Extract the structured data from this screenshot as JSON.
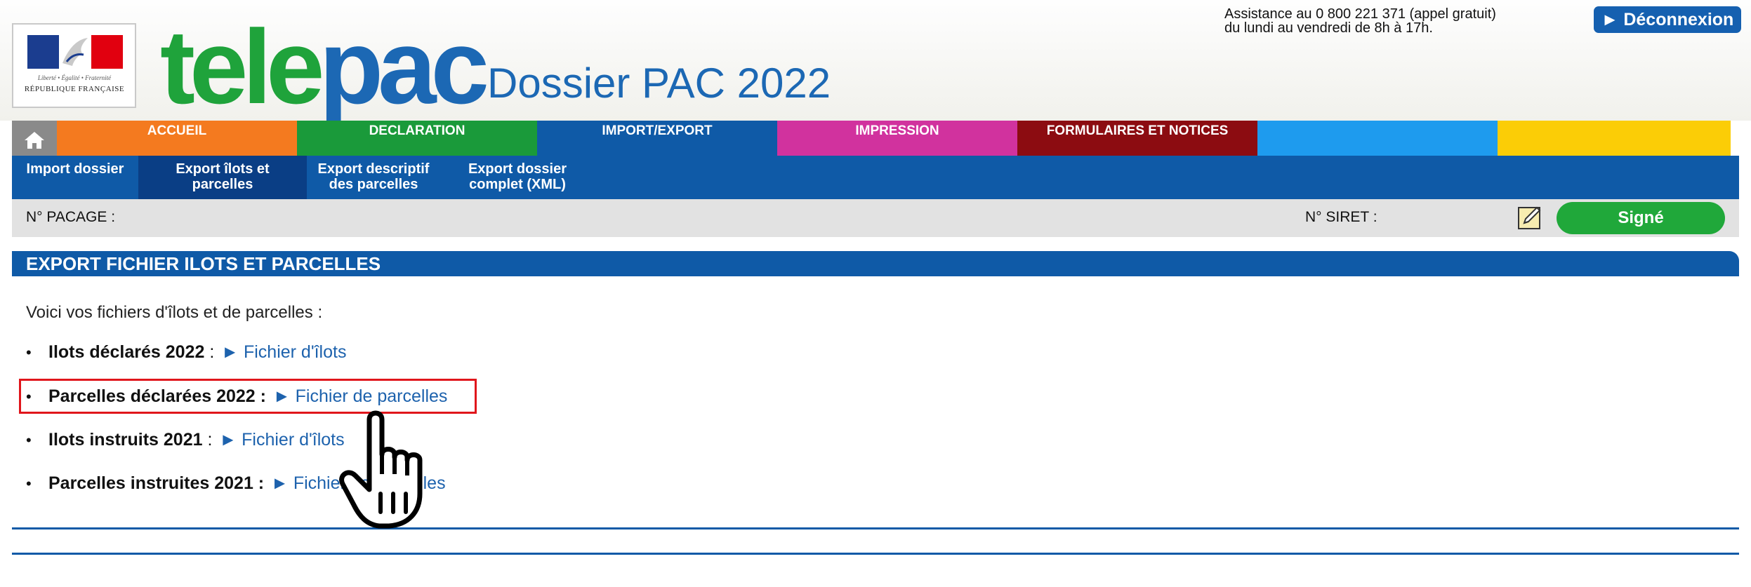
{
  "header": {
    "republic": {
      "motto": "Liberté • Égalité • Fraternité",
      "name": "RÉPUBLIQUE FRANÇAISE"
    },
    "logo": {
      "part1": "tele",
      "part2": "pac"
    },
    "title": "Dossier PAC 2022",
    "assistance_line1": "Assistance au 0 800 221 371 (appel gratuit)",
    "assistance_line2": "du lundi au vendredi de 8h à 17h.",
    "logout_label": "► Déconnexion"
  },
  "nav": {
    "tabs": [
      {
        "label": "ACCUEIL",
        "color": "#f47a1f"
      },
      {
        "label": "DECLARATION",
        "color": "#1a9a3a"
      },
      {
        "label": "IMPORT/EXPORT",
        "color": "#0f5aa7"
      },
      {
        "label": "IMPRESSION",
        "color": "#d1329e"
      },
      {
        "label": "FORMULAIRES ET NOTICES",
        "color": "#8c0c11"
      },
      {
        "label": "",
        "color": "#1e9bee"
      },
      {
        "label": "",
        "color": "#fbcd06"
      }
    ]
  },
  "subnav": {
    "items": [
      {
        "line1": "Import dossier",
        "line2": ""
      },
      {
        "line1": "Export îlots et",
        "line2": "parcelles"
      },
      {
        "line1": "Export descriptif",
        "line2": "des parcelles"
      },
      {
        "line1": "Export dossier",
        "line2": "complet (XML)"
      }
    ]
  },
  "info_bar": {
    "pacage_label": "N° PACAGE :",
    "siret_label": "N° SIRET :",
    "signed_label": "Signé"
  },
  "section": {
    "title": "EXPORT FICHIER ILOTS ET PARCELLES",
    "intro": "Voici vos fichiers d'îlots et de parcelles :",
    "files": [
      {
        "label": "Ilots déclarés 2022",
        "separator": " :",
        "link": "► Fichier d'îlots"
      },
      {
        "label": "Parcelles déclarées 2022 :",
        "separator": "",
        "link": "► Fichier de parcelles"
      },
      {
        "label": "Ilots instruits 2021",
        "separator": " :",
        "link": "► Fichier d'îlots"
      },
      {
        "label": "Parcelles instruites 2021 :",
        "separator": "",
        "link": "► Fichier de parcelles"
      }
    ]
  },
  "colors": {
    "primary_blue": "#0f5aa7",
    "highlight_red": "#e0161c",
    "signed_green": "#20a83a"
  }
}
